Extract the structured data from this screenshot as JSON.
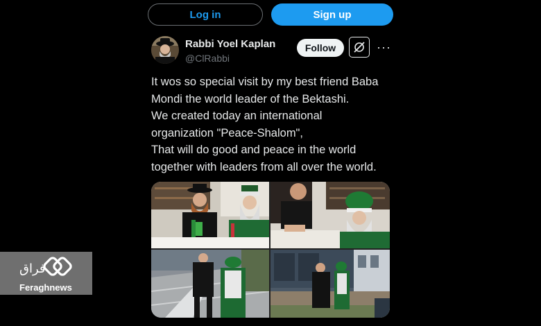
{
  "auth": {
    "login_label": "Log in",
    "signup_label": "Sign up"
  },
  "post": {
    "author_name": "Rabbi Yoel Kaplan",
    "author_handle": "@ClRabbi",
    "follow_label": "Follow",
    "more_label": "···",
    "text_lines": [
      "It wos so special visit by my best friend Baba",
      "Mondi the world leader of the Bektashi.",
      "We created today an international",
      "organization \"Peace-Shalom\",",
      "That will do good and peace in the world",
      "together with leaders from all over the world."
    ]
  },
  "watermark": {
    "brand": "Feraghnews",
    "logo_script": "فراق"
  },
  "colors": {
    "accent": "#1d9bf0",
    "background": "#000000",
    "text": "#e7e9ea",
    "muted": "#71767b"
  }
}
